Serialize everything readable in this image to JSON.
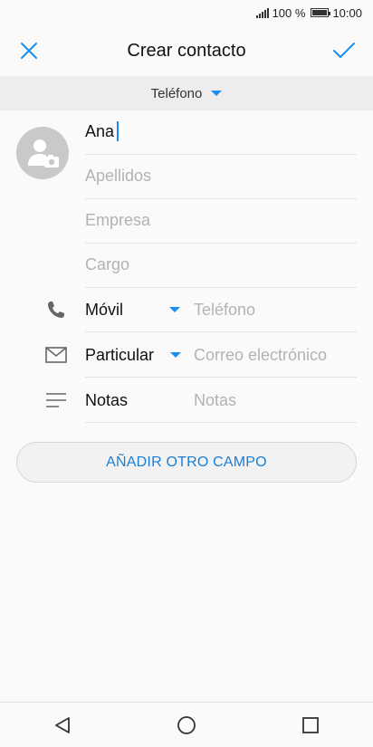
{
  "status": {
    "battery_text": "100 %",
    "time": "10:00"
  },
  "header": {
    "title": "Crear contacto"
  },
  "account": {
    "label": "Teléfono"
  },
  "name_fields": {
    "first_name_value": "Ana",
    "last_name_placeholder": "Apellidos",
    "company_placeholder": "Empresa",
    "job_placeholder": "Cargo"
  },
  "phone": {
    "type": "Móvil",
    "placeholder": "Teléfono"
  },
  "email": {
    "type": "Particular",
    "placeholder": "Correo electrónico"
  },
  "notes": {
    "label": "Notas",
    "placeholder": "Notas"
  },
  "add_field_label": "AÑADIR OTRO CAMPO",
  "icons": [
    "signal-icon",
    "battery-icon",
    "close-icon",
    "check-icon",
    "caret-down-icon",
    "avatar-camera-icon",
    "phone-icon",
    "mail-icon",
    "notes-icon",
    "back-icon",
    "home-icon",
    "recents-icon"
  ],
  "colors": {
    "accent": "#1a8ef0",
    "placeholder": "#b3b3b3"
  }
}
